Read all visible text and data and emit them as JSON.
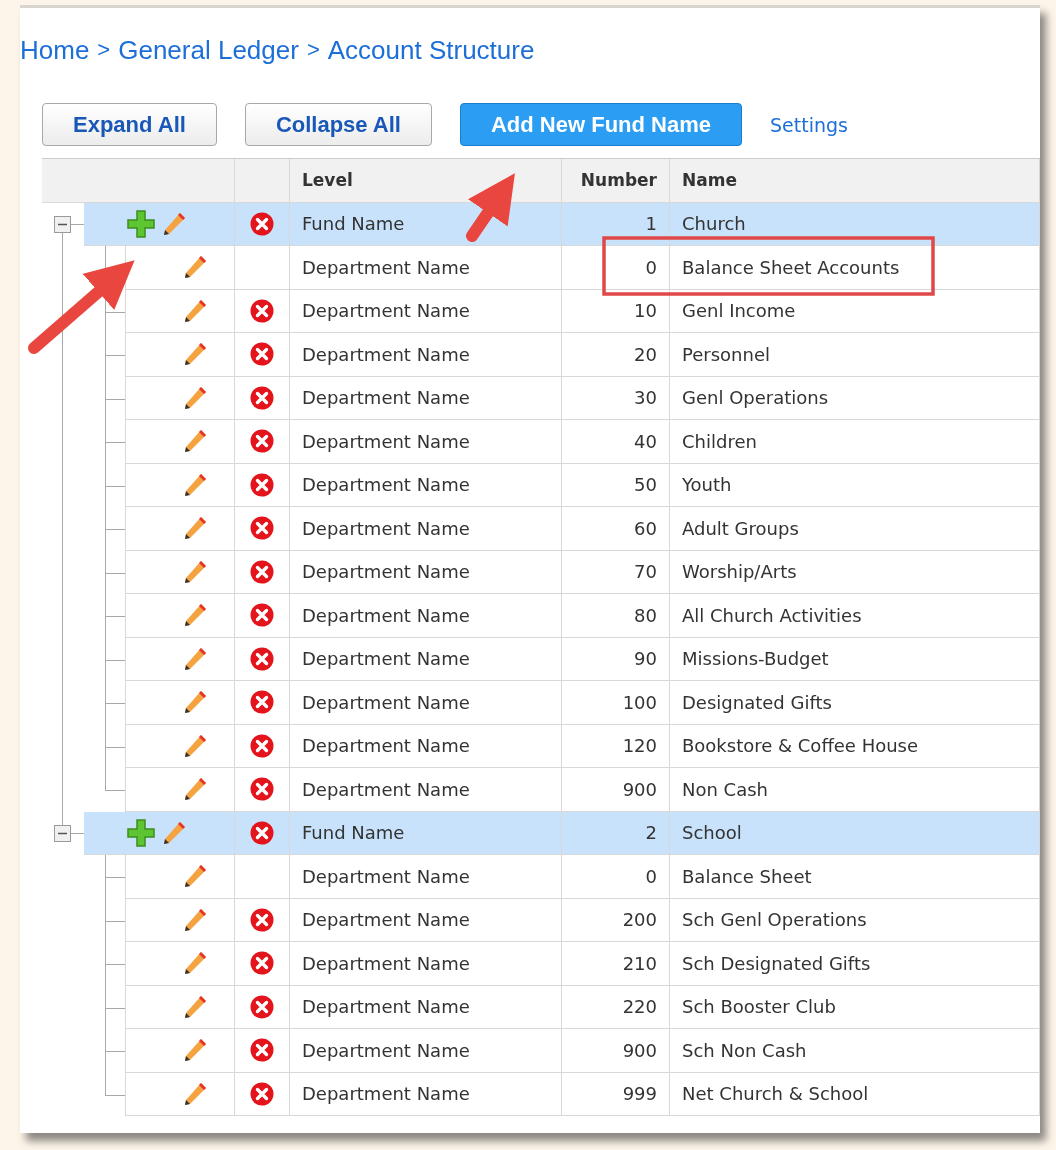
{
  "breadcrumb": [
    {
      "label": "Home"
    },
    {
      "label": "General Ledger"
    },
    {
      "label": "Account Structure"
    }
  ],
  "breadcrumb_separator": ">",
  "toolbar": {
    "buttons": [
      {
        "label": "Expand All",
        "kind": "plain"
      },
      {
        "label": "Collapse All",
        "kind": "plain"
      },
      {
        "label": "Add New Fund Name",
        "kind": "primary"
      }
    ],
    "link": "Settings"
  },
  "table": {
    "columns": [
      "Level",
      "Number",
      "Name"
    ],
    "funds": [
      {
        "level": "Fund Name",
        "number": "1",
        "name": "Church",
        "expanded": true,
        "deletable": true,
        "children": [
          {
            "level": "Department Name",
            "number": "0",
            "name": "Balance Sheet Accounts",
            "deletable": false
          },
          {
            "level": "Department Name",
            "number": "10",
            "name": "Genl Income",
            "deletable": true
          },
          {
            "level": "Department Name",
            "number": "20",
            "name": "Personnel",
            "deletable": true
          },
          {
            "level": "Department Name",
            "number": "30",
            "name": "Genl Operations",
            "deletable": true
          },
          {
            "level": "Department Name",
            "number": "40",
            "name": "Children",
            "deletable": true
          },
          {
            "level": "Department Name",
            "number": "50",
            "name": "Youth",
            "deletable": true
          },
          {
            "level": "Department Name",
            "number": "60",
            "name": "Adult Groups",
            "deletable": true
          },
          {
            "level": "Department Name",
            "number": "70",
            "name": "Worship/Arts",
            "deletable": true
          },
          {
            "level": "Department Name",
            "number": "80",
            "name": "All Church Activities",
            "deletable": true
          },
          {
            "level": "Department Name",
            "number": "90",
            "name": "Missions-Budget",
            "deletable": true
          },
          {
            "level": "Department Name",
            "number": "100",
            "name": "Designated Gifts",
            "deletable": true
          },
          {
            "level": "Department Name",
            "number": "120",
            "name": "Bookstore & Coffee House",
            "deletable": true
          },
          {
            "level": "Department Name",
            "number": "900",
            "name": "Non Cash",
            "deletable": true
          }
        ]
      },
      {
        "level": "Fund Name",
        "number": "2",
        "name": "School",
        "expanded": true,
        "deletable": true,
        "children": [
          {
            "level": "Department Name",
            "number": "0",
            "name": "Balance Sheet",
            "deletable": false
          },
          {
            "level": "Department Name",
            "number": "200",
            "name": "Sch Genl Operations",
            "deletable": true
          },
          {
            "level": "Department Name",
            "number": "210",
            "name": "Sch Designated Gifts",
            "deletable": true
          },
          {
            "level": "Department Name",
            "number": "220",
            "name": "Sch Booster Club",
            "deletable": true
          },
          {
            "level": "Department Name",
            "number": "900",
            "name": "Sch Non Cash",
            "deletable": true
          },
          {
            "level": "Department Name",
            "number": "999",
            "name": "Net Church & School",
            "deletable": true
          }
        ]
      }
    ]
  }
}
